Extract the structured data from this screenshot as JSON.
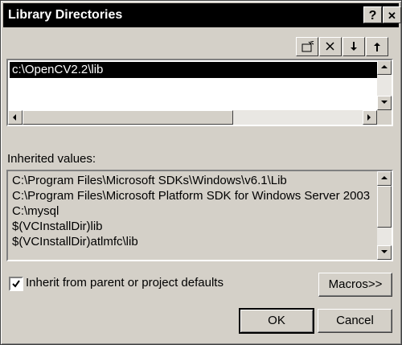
{
  "window": {
    "title": "Library Directories",
    "help_label": "?",
    "close_label": "✕"
  },
  "toolbar": {
    "new_line_icon": "new-line-icon",
    "delete_icon": "delete-icon",
    "move_down_icon": "arrow-down-icon",
    "move_up_icon": "arrow-up-icon"
  },
  "directories": {
    "items": [
      "c:\\OpenCV2.2\\lib"
    ]
  },
  "inherited": {
    "label": "Inherited values:",
    "items": [
      "C:\\Program Files\\Microsoft SDKs\\Windows\\v6.1\\Lib",
      "C:\\Program Files\\Microsoft Platform SDK for Windows Server 2003",
      "C:\\mysql",
      "$(VCInstallDir)lib",
      "$(VCInstallDir)atlmfc\\lib"
    ]
  },
  "inherit_checkbox": {
    "label": "Inherit from parent or project defaults",
    "checked": true
  },
  "buttons": {
    "macros": "Macros>>",
    "ok": "OK",
    "cancel": "Cancel"
  }
}
